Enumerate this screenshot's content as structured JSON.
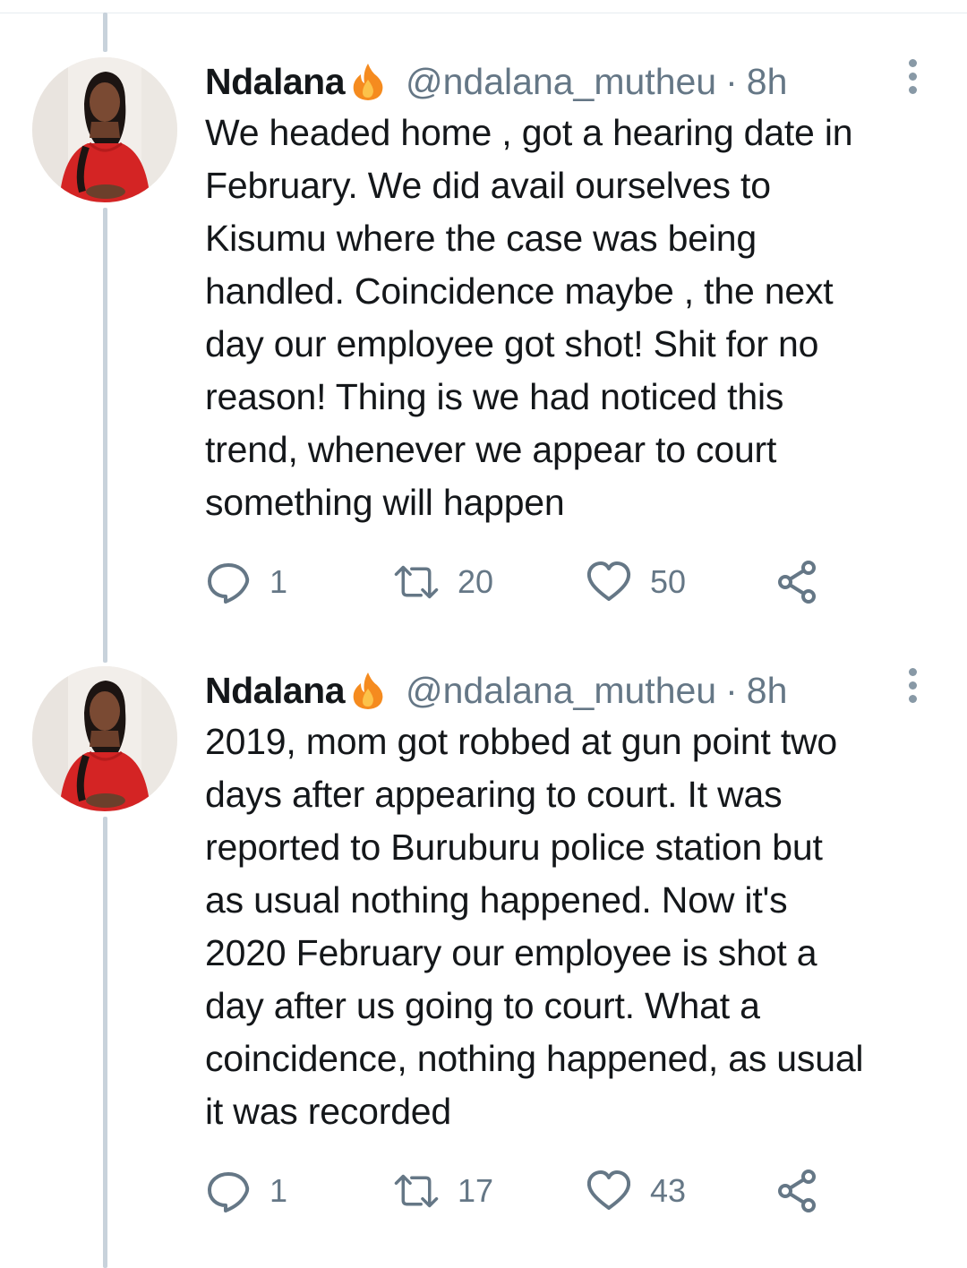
{
  "tweets": [
    {
      "name": "Ndalana",
      "handle": "@ndalana_mutheu",
      "separator": "·",
      "time": "8h",
      "text": "We headed home , got a hearing date in\nFebruary. We did avail ourselves to\nKisumu where the case was being\nhandled. Coincidence maybe , the next\nday our employee got shot! Shit for no\nreason! Thing is we had noticed this\ntrend, whenever we appear to court\nsomething will happen",
      "replies": "1",
      "retweets": "20",
      "likes": "50"
    },
    {
      "name": "Ndalana",
      "handle": "@ndalana_mutheu",
      "separator": "·",
      "time": "8h",
      "text": "2019, mom got robbed at gun point two\ndays after appearing to court. It was\nreported to Buruburu police station but\nas usual nothing happened. Now it's\n2020 February our employee is shot a\nday after us going to court. What a\ncoincidence, nothing happened, as usual\nit was recorded",
      "replies": "1",
      "retweets": "17",
      "likes": "43"
    }
  ],
  "icons": {
    "name_badge": "fire-icon",
    "menu": "more-vertical-icon",
    "reply": "reply-icon",
    "retweet": "retweet-icon",
    "like": "heart-icon",
    "share": "share-icon"
  },
  "colors": {
    "text": "#14171a",
    "muted": "#657786",
    "thread_line": "#c8d2db",
    "fire": "#f58b1f"
  }
}
